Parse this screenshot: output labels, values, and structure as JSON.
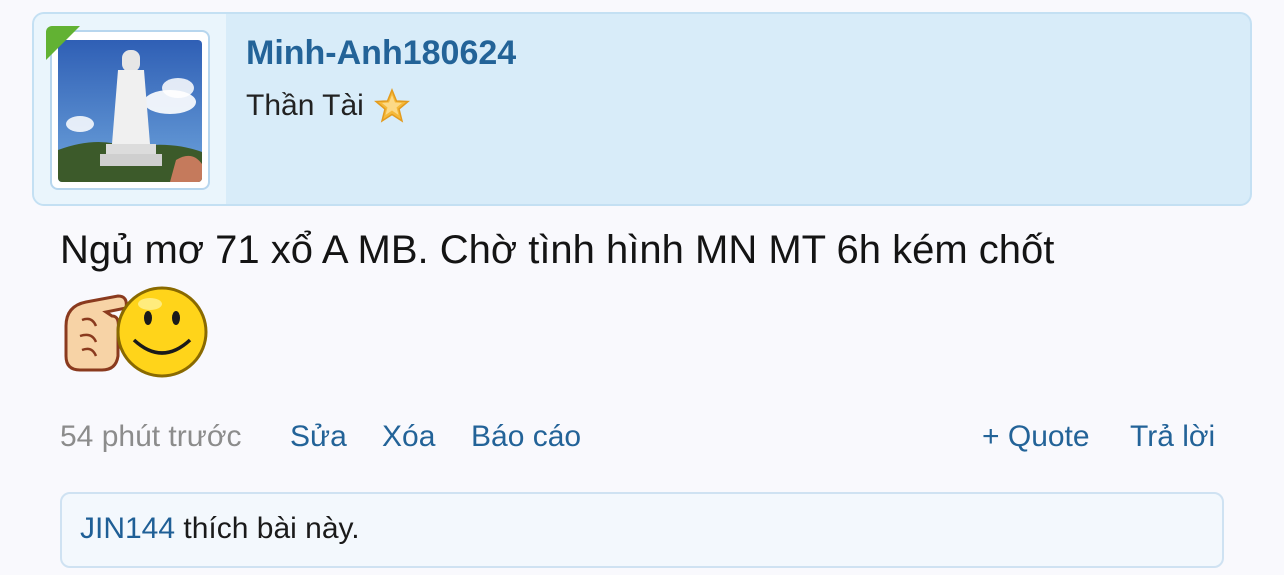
{
  "author": {
    "username": "Minh-Anh180624",
    "title": "Thần Tài",
    "avatar_icon": "statue-avatar",
    "rank_icon": "star-icon"
  },
  "post": {
    "text": "Ngủ mơ 71 xổ A MB. Chờ tình hình MN MT 6h kém chốt",
    "emoticon": "pointing-smiley-icon"
  },
  "actions": {
    "timestamp": "54 phút trước",
    "edit": "Sửa",
    "delete": "Xóa",
    "report": "Báo cáo",
    "quote": "+ Quote",
    "reply": "Trả lời"
  },
  "likes": {
    "user": "JIN144",
    "text": "thích bài này."
  },
  "colors": {
    "header_bg": "#d8ecf9",
    "link": "#236398",
    "username": "#1f5f96",
    "badge": "#62b233"
  }
}
